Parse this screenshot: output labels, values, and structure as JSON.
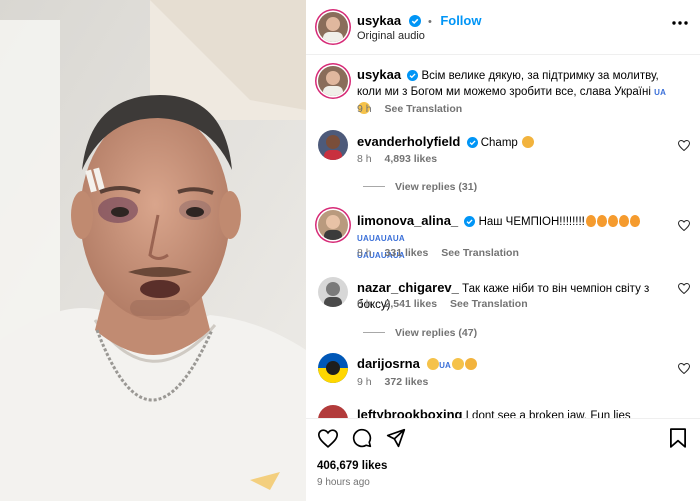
{
  "header": {
    "username": "usykaa",
    "follow_label": "Follow",
    "audio_label": "Original audio",
    "separator": "•"
  },
  "caption": {
    "username": "usykaa",
    "text": "Всім велике дякую, за підтримку за молитву, коли ми з Богом ми можемо зробити все, слава Україні",
    "flag_text": "UA",
    "time": "9 h",
    "translation_label": "See Translation"
  },
  "comments": [
    {
      "username": "evanderholyfield",
      "text": "Champ",
      "time": "8 h",
      "likes": "4,893 likes",
      "replies_label": "View replies (31)"
    },
    {
      "username": "limonova_alina_",
      "text": "Наш ЧЕМПІОН!!!!!!!!",
      "flag_run": "UAUAUAUA",
      "flag_run2": "UAUAUAUA",
      "time": "8 h",
      "likes": "331 likes",
      "translation_label": "See Translation"
    },
    {
      "username": "nazar_chigarev_",
      "text": "Так каже ніби то він чемпіон світу з боксу)",
      "time": "8 h",
      "likes": "2,541 likes",
      "translation_label": "See Translation",
      "replies_label": "View replies (47)"
    },
    {
      "username": "darijosrna",
      "flag_text": "UA",
      "time": "9 h",
      "likes": "372 likes"
    },
    {
      "username": "leftybrookboxing",
      "text": "I dont see a broken jaw. Fun lies"
    }
  ],
  "footer": {
    "likes": "406,679 likes",
    "time_ago": "9 hours ago"
  },
  "colors": {
    "link_blue": "#0095f6",
    "verified_blue": "#0095f6",
    "muted": "#737373"
  },
  "icons": [
    "verified-badge-icon",
    "heart-icon",
    "comment-icon",
    "share-icon",
    "bookmark-icon"
  ]
}
